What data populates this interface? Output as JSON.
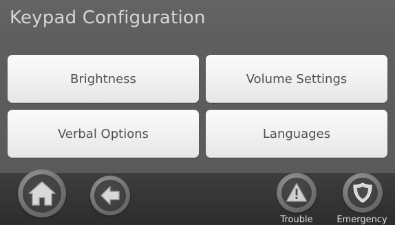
{
  "header": {
    "title": "Keypad Configuration"
  },
  "menu": {
    "brightness_label": "Brightness",
    "volume_label": "Volume Settings",
    "verbal_label": "Verbal Options",
    "languages_label": "Languages"
  },
  "footer": {
    "home_icon": "home-icon",
    "back_icon": "back-arrow-icon",
    "trouble_label": "Trouble",
    "trouble_icon": "warning-triangle-icon",
    "emergency_label": "Emergency",
    "emergency_icon": "shield-icon"
  },
  "colors": {
    "background": "#5e5e5e",
    "button_face": "#f1f1f1",
    "button_text": "#505050",
    "bar": "#2c2c2c"
  }
}
